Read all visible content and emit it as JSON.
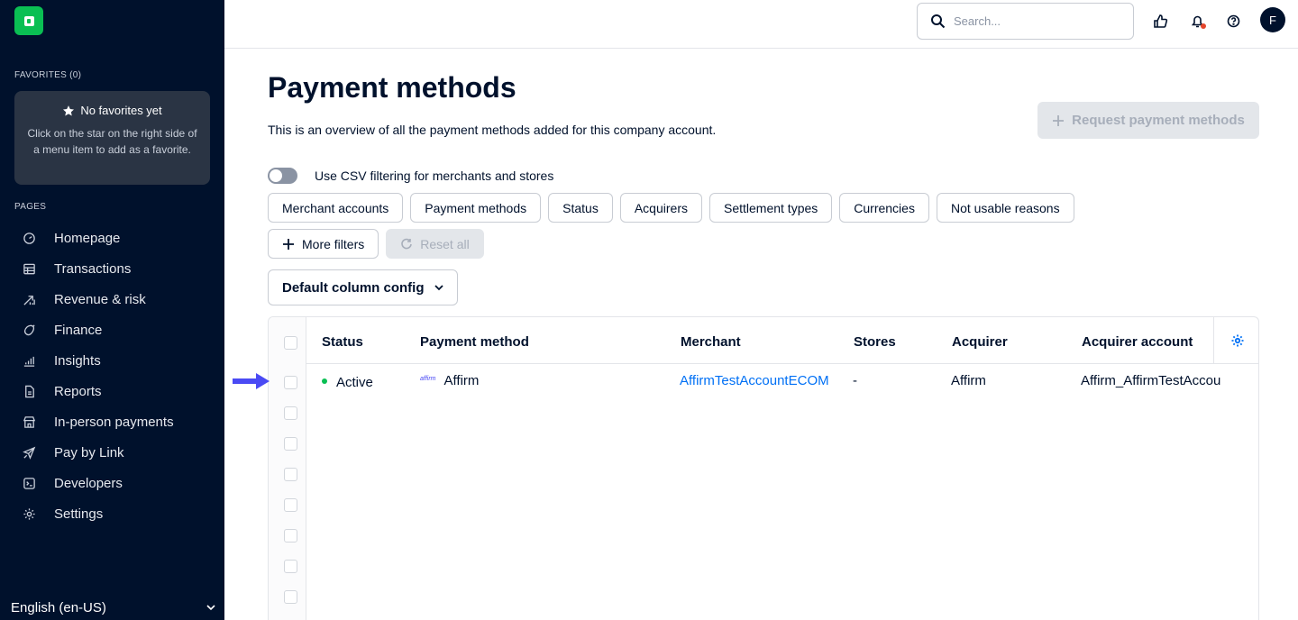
{
  "sidebar": {
    "favorites_header": "FAVORITES (0)",
    "favorites_title": "No favorites yet",
    "favorites_desc": "Click on the star on the right side of a menu item to add as a favorite.",
    "pages_header": "PAGES",
    "items": [
      {
        "label": "Homepage",
        "icon": "gauge-icon"
      },
      {
        "label": "Transactions",
        "icon": "table-icon"
      },
      {
        "label": "Revenue & risk",
        "icon": "chart-arrow-icon"
      },
      {
        "label": "Finance",
        "icon": "coin-icon"
      },
      {
        "label": "Insights",
        "icon": "bar-chart-icon"
      },
      {
        "label": "Reports",
        "icon": "document-icon"
      },
      {
        "label": "In-person payments",
        "icon": "store-icon"
      },
      {
        "label": "Pay by Link",
        "icon": "paper-plane-icon"
      },
      {
        "label": "Developers",
        "icon": "terminal-icon"
      },
      {
        "label": "Settings",
        "icon": "gear-icon"
      }
    ],
    "language": "English (en-US)"
  },
  "topbar": {
    "search_placeholder": "Search...",
    "avatar_initial": "F"
  },
  "main": {
    "title": "Payment methods",
    "description": "This is an overview of all the payment methods added for this company account.",
    "request_button": "Request payment methods",
    "csv_toggle_label": "Use CSV filtering for merchants and stores",
    "filters": [
      "Merchant accounts",
      "Payment methods",
      "Status",
      "Acquirers",
      "Settlement types",
      "Currencies",
      "Not usable reasons"
    ],
    "more_filters": "More filters",
    "reset_all": "Reset all",
    "column_config": "Default column config"
  },
  "table": {
    "columns": [
      "Status",
      "Payment method",
      "Merchant",
      "Stores",
      "Acquirer",
      "Acquirer account"
    ],
    "rows": [
      {
        "status": "Active",
        "payment_method": "Affirm",
        "payment_method_logo": "affirm",
        "merchant": "AffirmTestAccountECOM",
        "stores": "-",
        "acquirer": "Affirm",
        "acquirer_account": "Affirm_AffirmTestAccountECOM"
      }
    ]
  },
  "colors": {
    "sidebar_bg": "#00112c",
    "brand_green": "#0abf53",
    "link_blue": "#0070f5",
    "arrow_blue": "#4a4af4"
  }
}
